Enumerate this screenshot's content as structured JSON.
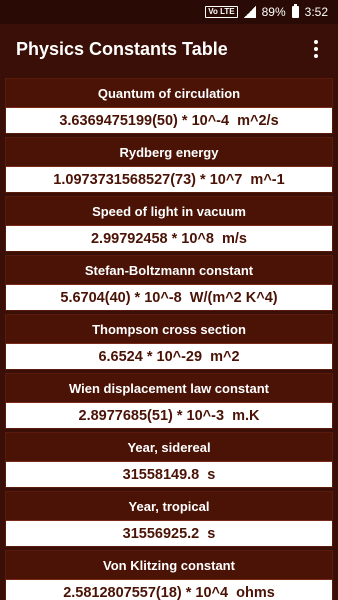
{
  "status_bar": {
    "network_badge": "Vo LTE",
    "battery": "89%",
    "time": "3:52"
  },
  "app_bar": {
    "title": "Physics Constants Table",
    "menu_icon": "overflow-menu-icon"
  },
  "constants": [
    {
      "name": "Quantum of circulation",
      "value": "3.6369475199(50) * 10^-4  m^2/s"
    },
    {
      "name": "Rydberg energy",
      "value": "1.0973731568527(73) * 10^7  m^-1"
    },
    {
      "name": "Speed of light in vacuum",
      "value": "2.99792458 * 10^8  m/s"
    },
    {
      "name": "Stefan-Boltzmann constant",
      "value": "5.6704(40) * 10^-8  W/(m^2 K^4)"
    },
    {
      "name": "Thompson cross section",
      "value": "6.6524 * 10^-29  m^2"
    },
    {
      "name": "Wien displacement law constant",
      "value": "2.8977685(51) * 10^-3  m.K"
    },
    {
      "name": "Year, sidereal",
      "value": "31558149.8  s"
    },
    {
      "name": "Year, tropical",
      "value": "31556925.2  s"
    },
    {
      "name": "Von Klitzing constant",
      "value": "2.5812807557(18) * 10^4  ohms"
    }
  ],
  "colors": {
    "app_bar": "#3a0f07",
    "card_header": "#4a1306",
    "value_text": "#4a1306",
    "card_body": "#ffffff"
  }
}
